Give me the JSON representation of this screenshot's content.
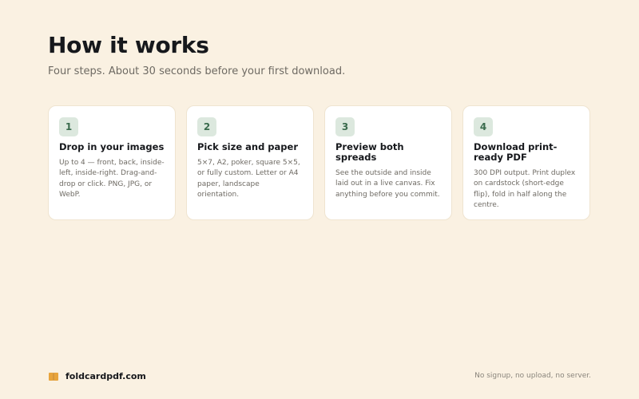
{
  "header": {
    "title": "How it works",
    "subtitle": "Four steps. About 30 seconds before your first download."
  },
  "steps": [
    {
      "number": "1",
      "title": "Drop in your images",
      "description": "Up to 4 — front, back, inside-left, inside-right. Drag-and-drop or click. PNG, JPG, or WebP."
    },
    {
      "number": "2",
      "title": "Pick size and paper",
      "description": "5×7, A2, poker, square 5×5, or fully custom. Letter or A4 paper, landscape orientation."
    },
    {
      "number": "3",
      "title": "Preview both spreads",
      "description": "See the outside and inside laid out in a live canvas. Fix anything before you commit."
    },
    {
      "number": "4",
      "title": "Download print-ready PDF",
      "description": "300 DPI output. Print duplex on cardstock (short-edge flip), fold in half along the centre."
    }
  ],
  "footer": {
    "brand": "foldcardpdf.com",
    "brand_icon": "open-book-icon",
    "note": "No signup, no upload, no server."
  },
  "colors": {
    "background": "#faf1e2",
    "card": "#ffffff",
    "badge_bg": "#dce8de",
    "badge_text": "#3a6b4d",
    "logo": "#e8a43c"
  }
}
